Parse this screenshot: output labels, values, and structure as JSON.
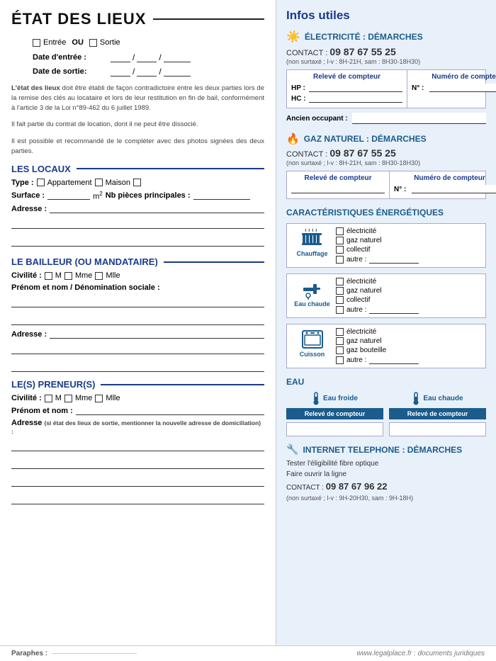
{
  "left": {
    "title": "ÉTAT DES LIEUX",
    "entry_label": "Entrée",
    "ou_label": "OU",
    "exit_label": "Sortie",
    "date_entree_label": "Date d'entrée :",
    "date_sortie_label": "Date de sortie:",
    "description": {
      "part1_strong": "L'état des lieux",
      "part1_rest": " doit être établi de façon contradictoire entre les deux parties lors de la remise des clés au locataire et lors de leur restitution en fin de bail, conformément à l'article 3 de la Loi n°89-462 du 6 juillet 1989.",
      "part2": "Il fait partie du contrat de location, dont il ne peut être dissocié.",
      "part3": "Il est possible et recommandé de le compléter avec des photos signées des deux parties."
    },
    "les_locaux": {
      "title": "LES LOCAUX",
      "type_label": "Type :",
      "appartement": "Appartement",
      "maison": "Maison",
      "surface_label": "Surface :",
      "surface_unit": "m²",
      "nb_pieces_label": "Nb pièces principales :",
      "adresse_label": "Adresse :"
    },
    "bailleur": {
      "title": "LE BAILLEUR (OU MANDATAIRE)",
      "civilite_label": "Civilité :",
      "m_label": "M",
      "mme_label": "Mme",
      "mlle_label": "Mlle",
      "prenom_label": "Prénom et nom / Dénomination sociale :",
      "adresse_label": "Adresse :"
    },
    "preneur": {
      "title": "LE(S) PRENEUR(S)",
      "civilite_label": "Civilité :",
      "m_label": "M",
      "mme_label": "Mme",
      "mlle_label": "Mlle",
      "prenom_label": "Prénom et nom :",
      "adresse_label": "Adresse",
      "adresse_note": "(si état des lieux de sortie, mentionner la nouvelle adresse de domiciliation) :"
    }
  },
  "right": {
    "title": "Infos utiles",
    "electricite": {
      "title": "ÉLECTRICITÉ : DÉMARCHES",
      "contact_label": "CONTACT :",
      "contact_number": "09 87 67 55 25",
      "contact_note": "(non surtaxé ; l-v : 8H-21H, sam : 8H30-18H30)",
      "releve_header": "Relevé de compteur",
      "numero_header": "Numéro de compteur",
      "hp_label": "HP :",
      "hc_label": "HC :",
      "n_label": "N° :",
      "ancien_label": "Ancien occupant :"
    },
    "gaz": {
      "title": "GAZ NATUREL : DÉMARCHES",
      "contact_label": "CONTACT :",
      "contact_number": "09 87 67 55 25",
      "contact_note": "(non surtaxé ; l-v : 8H-21H, sam : 8H30-18H30)",
      "releve_header": "Relevé de compteur",
      "numero_header": "Numéro de compteur",
      "n_label": "N° :"
    },
    "carac": {
      "title": "CARACTÉRISTIQUES ÉNERGÉTIQUES",
      "chauffage_label": "Chauffage",
      "eau_chaude_label": "Eau chaude",
      "cuisson_label": "Cuisson",
      "electricite": "électricité",
      "gaz_naturel": "gaz naturel",
      "collectif": "collectif",
      "autre": "autre :",
      "gaz_bouteille": "gaz bouteille"
    },
    "eau": {
      "title": "EAU",
      "froide_label": "Eau froide",
      "chaude_label": "Eau chaude",
      "releve_label": "Relevé de compteur"
    },
    "internet": {
      "title": "INTERNET TELEPHONE : DÉMARCHES",
      "line1": "Tester l'éligibilité fibre optique",
      "line2": "Faire ouvrir la ligne",
      "contact_label": "CONTACT :",
      "contact_number": "09 87 67 96 22",
      "contact_note": "(non surtaxé ; l-v : 9H-20H30, sam : 9H-18H)"
    }
  },
  "footer": {
    "paraphe_label": "Paraphes :",
    "website": "www.legalplace.fr : documents juridiques"
  }
}
